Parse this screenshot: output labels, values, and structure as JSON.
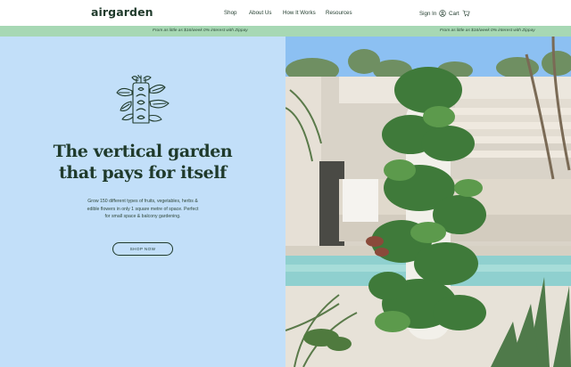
{
  "header": {
    "brand": "airgarden",
    "nav": [
      {
        "label": "Shop"
      },
      {
        "label": "About Us"
      },
      {
        "label": "How It Works"
      },
      {
        "label": "Resources"
      }
    ],
    "signin_label": "Sign In",
    "cart_label": "Cart"
  },
  "promo": {
    "text_left": "From as little as $16/week 0% interest with Zippay",
    "text_right": "From as little as $16/week 0% interest with Zippay"
  },
  "hero": {
    "headline_line1": "The vertical garden",
    "headline_line2": "that pays for itself",
    "subtext": "Grow 150 different types of fruits, vegetables, herbs & edible flowers in only 1 square metre of space. Perfect for small space & balcony gardening.",
    "cta_label": "SHOP NOW"
  },
  "colors": {
    "primary_text": "#1f3a2b",
    "promo_bg": "#a7d8b4",
    "hero_left_bg": "#c2dff9"
  },
  "icons": [
    "user-icon",
    "cart-icon",
    "plant-tower-logo-icon"
  ]
}
